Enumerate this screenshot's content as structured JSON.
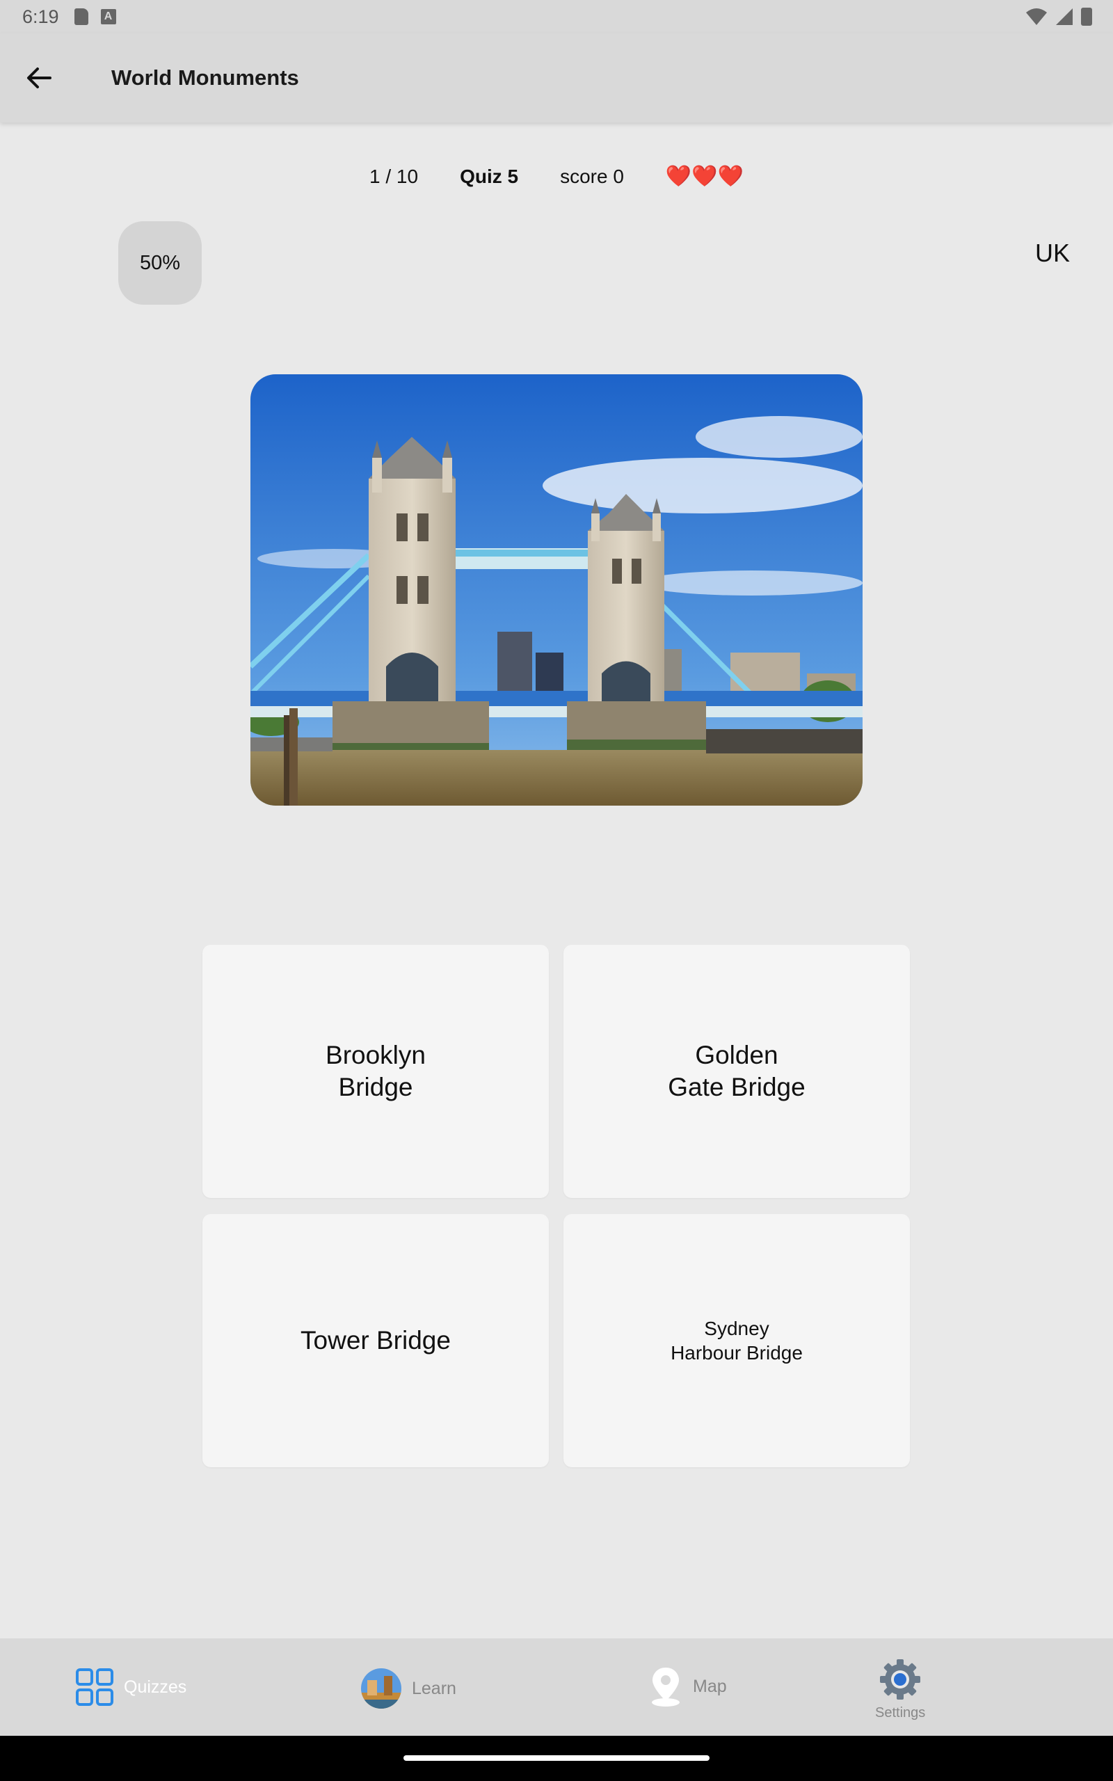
{
  "status_bar": {
    "time": "6:19"
  },
  "app_bar": {
    "title": "World Monuments"
  },
  "quiz": {
    "progress": "1 / 10",
    "name": "Quiz 5",
    "score": "score 0",
    "hearts": "❤️❤️❤️",
    "hint": "50%",
    "region": "UK"
  },
  "answers": [
    "Brooklyn\nBridge",
    "Golden\nGate Bridge",
    "Tower Bridge",
    "Sydney\nHarbour Bridge"
  ],
  "nav": {
    "quizzes": "Quizzes",
    "learn": "Learn",
    "map": "Map",
    "settings": "Settings",
    "active": "quizzes"
  },
  "colors": {
    "accent": "#2b8ce8",
    "nav_bg": "#d9d9d9",
    "card_bg": "#f5f5f5"
  }
}
